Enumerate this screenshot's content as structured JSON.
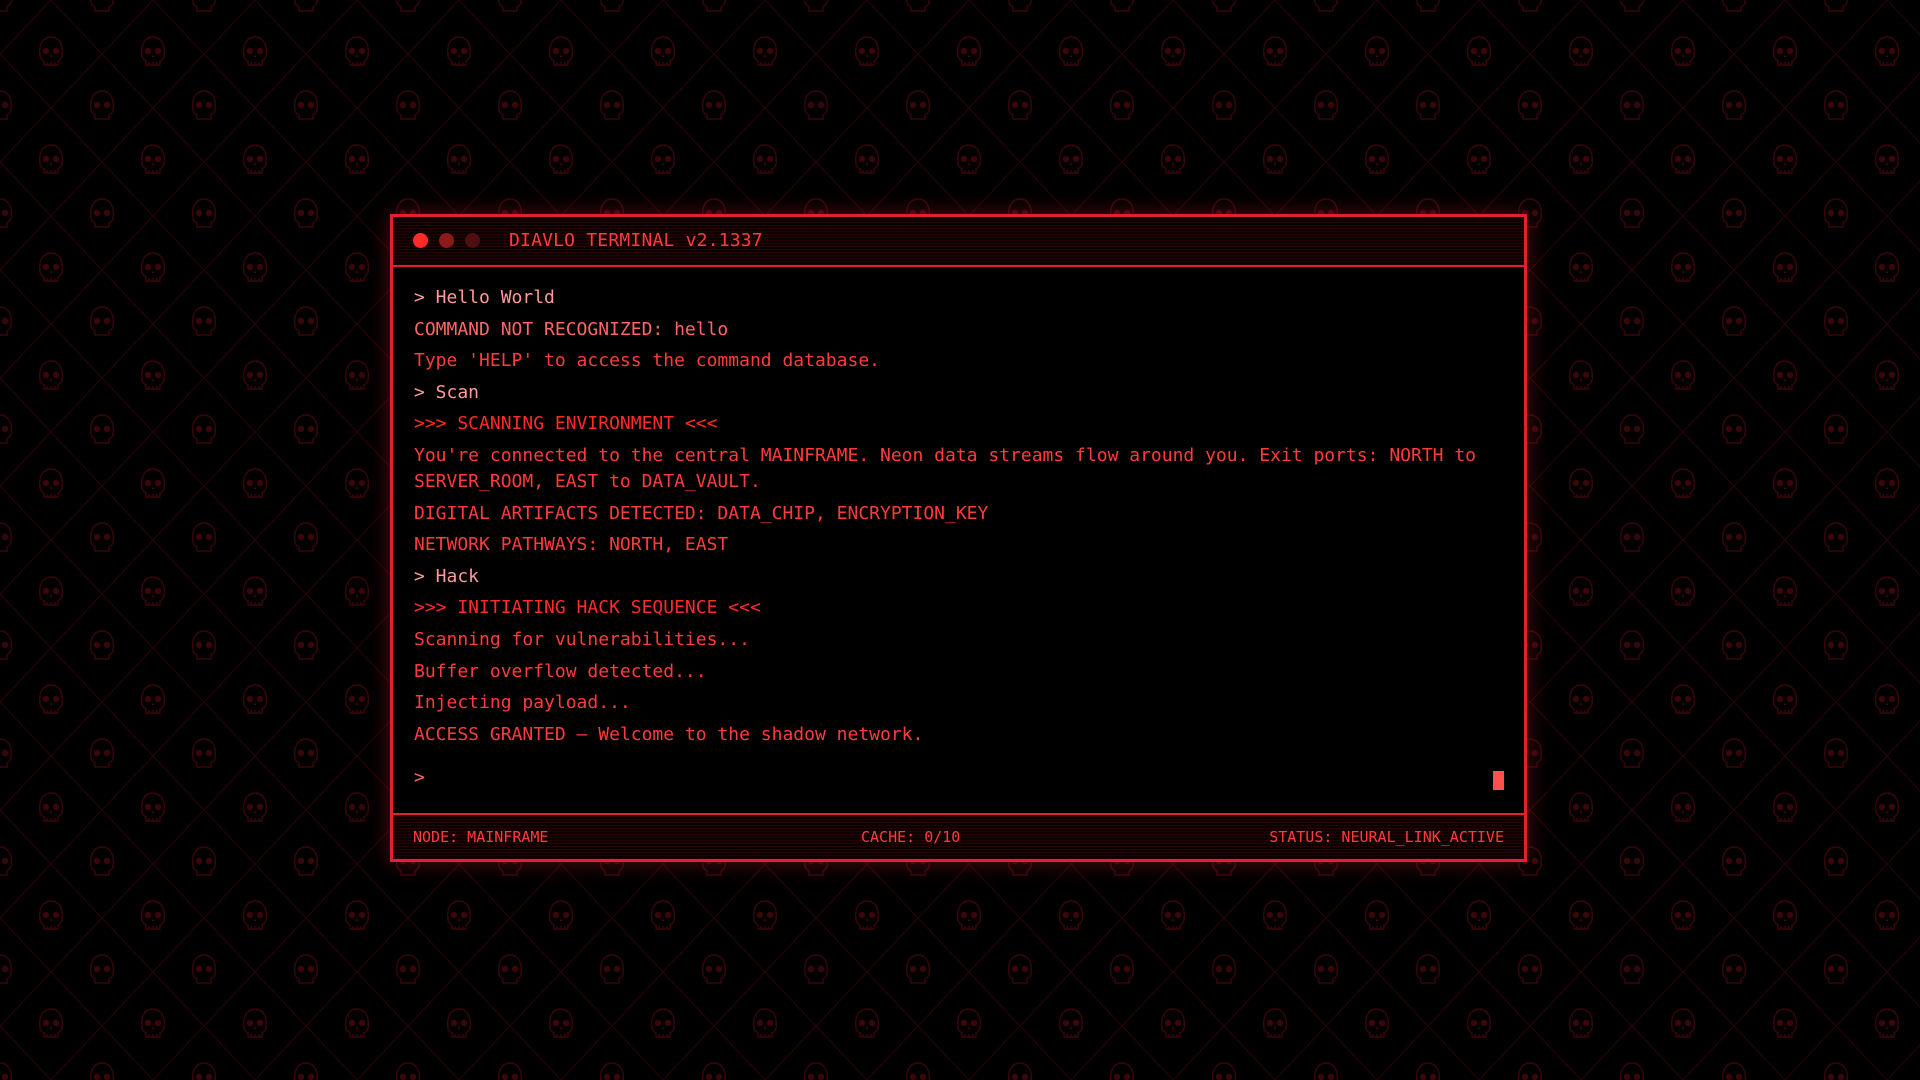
{
  "colors": {
    "accent": "#e3202d",
    "background": "#000000",
    "text": "#ff3b3b"
  },
  "background": {
    "pattern_icon": "skull-icon"
  },
  "window": {
    "title": "DIAVLO TERMINAL v2.1337",
    "controls": [
      "close-dot-icon",
      "minimize-dot-icon",
      "maximize-dot-icon"
    ]
  },
  "terminal": {
    "lines": [
      {
        "kind": "cmd",
        "text": "> Hello World"
      },
      {
        "kind": "sys",
        "text": "COMMAND NOT RECOGNIZED: hello"
      },
      {
        "kind": "body",
        "text": "Type 'HELP' to access the command database."
      },
      {
        "kind": "cmd",
        "text": "> Scan"
      },
      {
        "kind": "head",
        "text": ">>> SCANNING ENVIRONMENT <<<"
      },
      {
        "kind": "body",
        "text": "You're connected to the central MAINFRAME. Neon data streams flow around you. Exit ports: NORTH to SERVER_ROOM, EAST to DATA_VAULT."
      },
      {
        "kind": "body",
        "text": "DIGITAL ARTIFACTS DETECTED: DATA_CHIP, ENCRYPTION_KEY"
      },
      {
        "kind": "body",
        "text": "NETWORK PATHWAYS: NORTH, EAST"
      },
      {
        "kind": "cmd",
        "text": "> Hack"
      },
      {
        "kind": "head",
        "text": ">>> INITIATING HACK SEQUENCE <<<"
      },
      {
        "kind": "body",
        "text": "Scanning for vulnerabilities..."
      },
      {
        "kind": "body",
        "text": "Buffer overflow detected..."
      },
      {
        "kind": "body",
        "text": "Injecting payload..."
      },
      {
        "kind": "body",
        "text": "ACCESS GRANTED – Welcome to the shadow network."
      }
    ],
    "prompt": ">",
    "input_value": ""
  },
  "status": {
    "node": "NODE: MAINFRAME",
    "cache": "CACHE: 0/10",
    "status": "STATUS: NEURAL_LINK_ACTIVE"
  }
}
